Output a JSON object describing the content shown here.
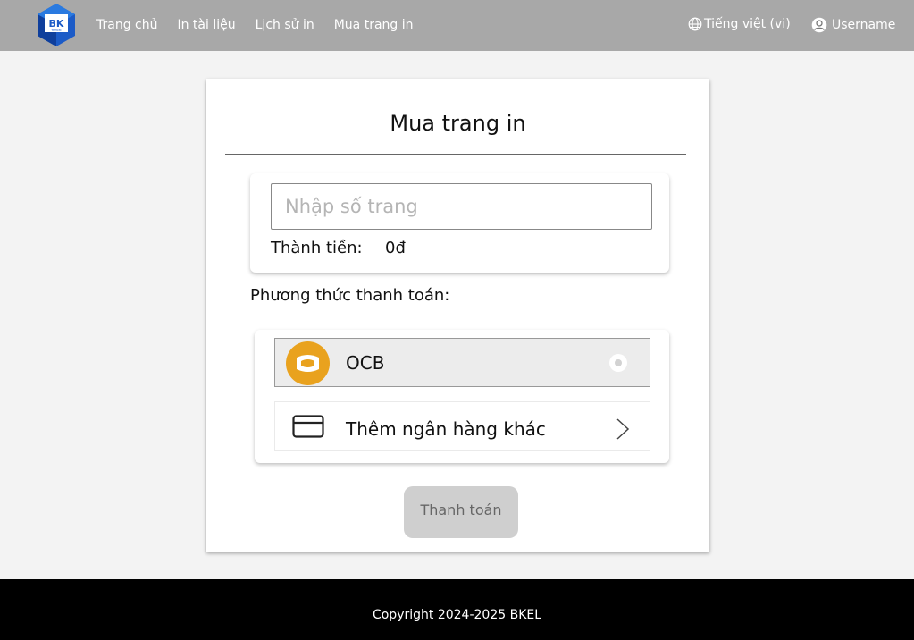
{
  "header": {
    "logo_text": "BK",
    "nav": [
      "Trang chủ",
      "In tài liệu",
      "Lịch sử in",
      "Mua trang in"
    ],
    "language_label": "Tiếng việt (vi)",
    "username": "Username"
  },
  "card": {
    "title": "Mua trang in",
    "pages_input": {
      "value": "",
      "placeholder": "Nhập số trang"
    },
    "total_label": "Thành tiền:",
    "total_value": "0đ",
    "payment_method_label": "Phương thức thanh toán:",
    "methods": [
      {
        "label": "OCB",
        "icon": "ocb-logo-icon"
      },
      {
        "label": "Thêm ngân hàng khác",
        "icon": "credit-card-icon"
      }
    ],
    "pay_button_label": "Thanh toán"
  },
  "footer": {
    "copyright": "Copyright 2024-2025 BKEL"
  },
  "colors": {
    "header_bg": "#a8a8a8",
    "page_bg": "#f3f3f3",
    "footer_bg": "#000000",
    "ocb_orange": "#e9a21e",
    "logo_blue": "#1c5bc7",
    "button_bg": "#cfcfcf"
  }
}
